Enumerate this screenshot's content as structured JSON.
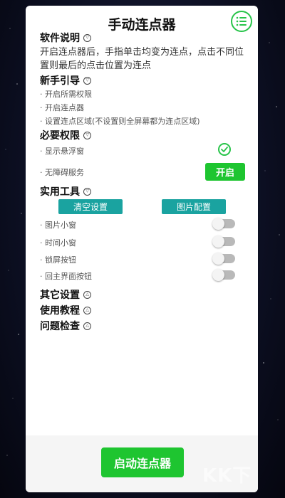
{
  "header": {
    "title": "手动连点器",
    "menu_icon": "list-icon"
  },
  "software_info": {
    "label": "软件说明",
    "text": "开启连点器后，手指单击均变为连点，点击不同位置则最后的点击位置为连点"
  },
  "guide": {
    "label": "新手引导",
    "items": [
      "· 开启所需权限",
      "· 开启连点器",
      "· 设置连点区域(不设置则全屏幕都为连点区域)"
    ]
  },
  "permissions": {
    "label": "必要权限",
    "overlay_label": "· 显示悬浮窗",
    "overlay_granted": true,
    "accessibility_label": "· 无障碍服务",
    "accessibility_button": "开启"
  },
  "tools": {
    "label": "实用工具",
    "clear_button": "清空设置",
    "image_config_button": "图片配置",
    "toggles": [
      {
        "label": "· 图片小窗",
        "on": false
      },
      {
        "label": "· 时间小窗",
        "on": false
      },
      {
        "label": "· 锁屏按钮",
        "on": false
      },
      {
        "label": "· 回主界面按钮",
        "on": false
      }
    ]
  },
  "collapsed_sections": [
    "其它设置",
    "使用教程",
    "问题检查"
  ],
  "start_button": "启动连点器",
  "watermark": "KK下",
  "colors": {
    "accent_green": "#1ec530",
    "teal": "#1aa3a0"
  }
}
